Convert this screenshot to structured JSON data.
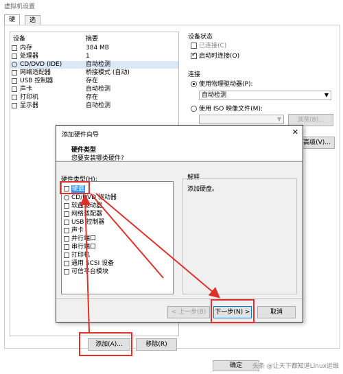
{
  "window": {
    "title": "虚拟机设置"
  },
  "tabs": [
    {
      "label": "硬件"
    },
    {
      "label": "选项"
    }
  ],
  "device_list": {
    "headers": {
      "device": "设备",
      "summary": "摘要"
    },
    "rows": [
      {
        "name": "内存",
        "summary": "384 MB",
        "icon": "memory-icon"
      },
      {
        "name": "处理器",
        "summary": "1",
        "icon": "cpu-icon"
      },
      {
        "name": "CD/DVD (IDE)",
        "summary": "自动检测",
        "icon": "cd-dvd-icon"
      },
      {
        "name": "网络适配器",
        "summary": "桥接模式 (自动)",
        "icon": "network-icon"
      },
      {
        "name": "USB 控制器",
        "summary": "存在",
        "icon": "usb-icon"
      },
      {
        "name": "声卡",
        "summary": "自动检测",
        "icon": "sound-icon"
      },
      {
        "name": "打印机",
        "summary": "存在",
        "icon": "printer-icon"
      },
      {
        "name": "显示器",
        "summary": "自动检测",
        "icon": "display-icon"
      }
    ]
  },
  "device_status": {
    "label": "设备状态",
    "connected": "已连接(C)",
    "connect_on_power": "启动时连接(O)"
  },
  "connection": {
    "label": "连接",
    "physical_drive": "使用物理驱动器(P):",
    "drive_value": "自动检测",
    "iso_file": "使用 ISO 映像文件(M):",
    "browse": "浏览(B)...",
    "advanced": "高级(V)..."
  },
  "dialog": {
    "title": "添加硬件向导",
    "heading": "硬件类型",
    "subheading": "您要安装哪类硬件?",
    "hw_type_label": "硬件类型(H):",
    "hw_types": [
      {
        "name": "硬盘",
        "icon": "hard-disk-icon"
      },
      {
        "name": "CD/DVD 驱动器",
        "icon": "cd-dvd-icon"
      },
      {
        "name": "软盘驱动器",
        "icon": "floppy-icon"
      },
      {
        "name": "网络适配器",
        "icon": "network-icon"
      },
      {
        "name": "USB 控制器",
        "icon": "usb-icon"
      },
      {
        "name": "声卡",
        "icon": "sound-icon"
      },
      {
        "name": "并行端口",
        "icon": "parallel-port-icon"
      },
      {
        "name": "串行端口",
        "icon": "serial-port-icon"
      },
      {
        "name": "打印机",
        "icon": "printer-icon"
      },
      {
        "name": "通用 SCSI 设备",
        "icon": "scsi-icon"
      },
      {
        "name": "可信平台模块",
        "icon": "tpm-icon"
      }
    ],
    "explain_label": "解释",
    "explain_text": "添加硬盘。",
    "back": "< 上一步(B)",
    "next": "下一步(N) >",
    "cancel": "取消"
  },
  "bottom": {
    "add": "添加(A)...",
    "remove": "移除(R)",
    "ok": "确定",
    "watermark": "头条 @让天下都知道Linux运维"
  },
  "accent": {
    "red": "#e0302a",
    "selection": "#3399ff"
  }
}
